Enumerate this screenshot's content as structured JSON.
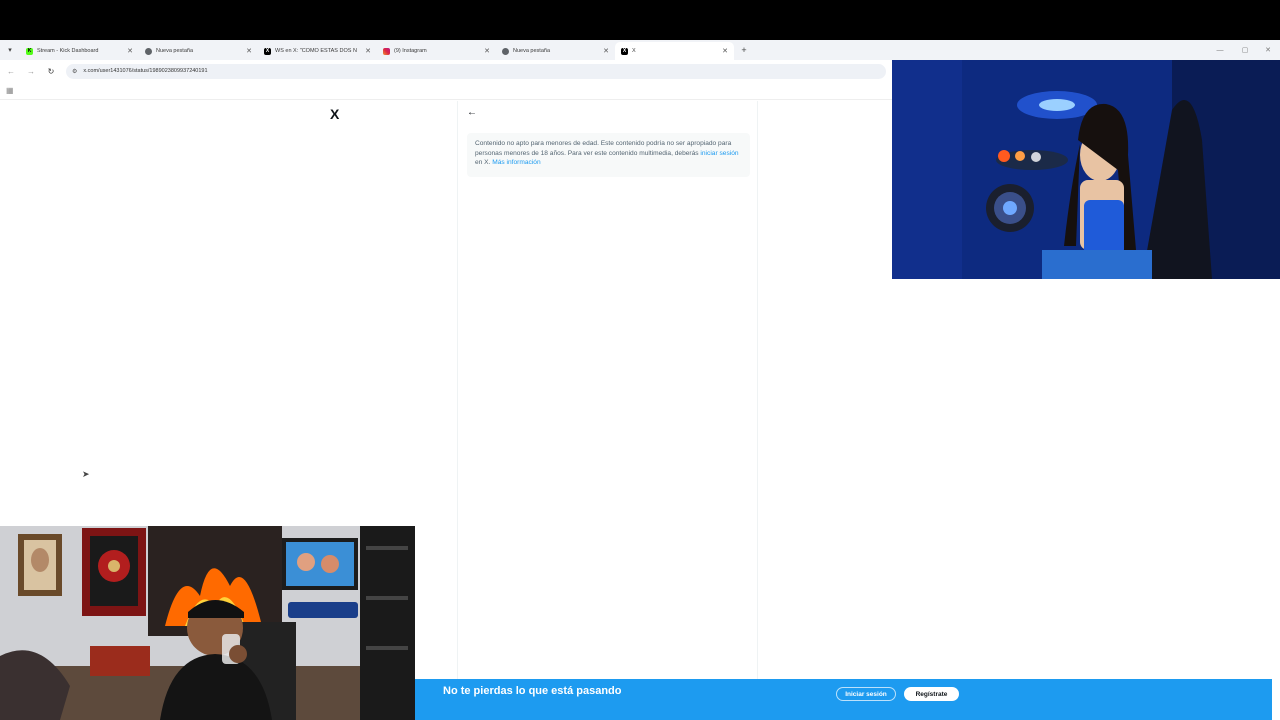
{
  "browser": {
    "tabs": [
      {
        "title": "Stream - Kick Dashboard",
        "favicon": "kick-icon",
        "color": "#53fc18",
        "active": false
      },
      {
        "title": "Nueva pestaña",
        "favicon": "chrome-icon",
        "color": "#5f6368",
        "active": false
      },
      {
        "title": "WS en X: \"COMO ESTAS DOS N",
        "favicon": "x-icon",
        "color": "#000000",
        "active": false
      },
      {
        "title": "(9) Instagram",
        "favicon": "instagram-icon",
        "color": "#d6249f",
        "active": false
      },
      {
        "title": "Nueva pestaña",
        "favicon": "chrome-icon",
        "color": "#5f6368",
        "active": false
      },
      {
        "title": "X",
        "favicon": "x-icon",
        "color": "#000000",
        "active": true
      }
    ],
    "url": "x.com/user1431076/status/1989023809937240191"
  },
  "page": {
    "logo": "X",
    "warning": {
      "text_before": "Contenido no apto para menores de edad. Este contenido podría no ser apropiado para personas menores de 18 años. Para ver este contenido multimedia, deberás ",
      "login_link": "iniciar sesión",
      "text_middle": " en X. ",
      "more_link": "Más información"
    }
  },
  "banner": {
    "text": "No te pierdas lo que está pasando",
    "login_label": "Iniciar sesión",
    "signup_label": "Regístrate",
    "color": "#1d9bf0"
  },
  "colors": {
    "link": "#1d9bf0",
    "text_secondary": "#536471"
  }
}
